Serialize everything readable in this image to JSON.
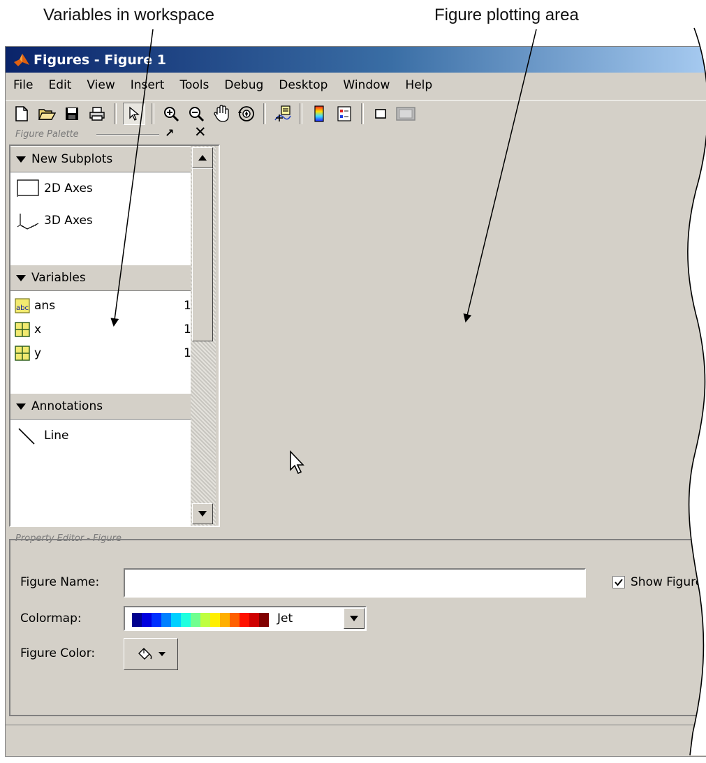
{
  "callouts": {
    "variables": "Variables in workspace",
    "figure": "Figure plotting area"
  },
  "window": {
    "title": "Figures - Figure 1"
  },
  "menu": [
    "File",
    "Edit",
    "View",
    "Insert",
    "Tools",
    "Debug",
    "Desktop",
    "Window",
    "Help"
  ],
  "toolbar": {
    "icons": [
      "new-figure-icon",
      "open-file-icon",
      "save-icon",
      "print-icon",
      "edit-plot-arrow-icon",
      "zoom-in-icon",
      "zoom-out-icon",
      "pan-hand-icon",
      "rotate-3d-icon",
      "data-cursor-icon",
      "insert-colorbar-icon",
      "insert-legend-icon",
      "hide-plot-tools-icon",
      "show-plot-tools-icon"
    ]
  },
  "palette": {
    "caption": "Figure Palette",
    "sections": {
      "subplots": "New Subplots",
      "variables": "Variables",
      "annotations": "Annotations"
    },
    "subplots": [
      "2D Axes",
      "3D Axes"
    ],
    "variables": [
      {
        "name": "ans",
        "size": "1",
        "icon": "char-variable-icon"
      },
      {
        "name": "x",
        "size": "1",
        "icon": "matrix-variable-icon"
      },
      {
        "name": "y",
        "size": "1",
        "icon": "matrix-variable-icon"
      }
    ],
    "annotations": [
      "Line"
    ]
  },
  "property_editor": {
    "caption": "Property Editor - Figure",
    "figure_name_label": "Figure Name:",
    "figure_name_value": "",
    "show_figure_label": "Show Figure",
    "show_figure_checked": true,
    "colormap_label": "Colormap:",
    "colormap_value": "Jet",
    "figure_color_label": "Figure Color:"
  },
  "colors": {
    "titlebar_start": "#0a246a",
    "panel_bg": "#d4d0c8",
    "jet": [
      "#00008f",
      "#0000df",
      "#0030ff",
      "#0080ff",
      "#00d0ff",
      "#20ffdf",
      "#70ff8f",
      "#bfff40",
      "#ffef00",
      "#ffaf00",
      "#ff6000",
      "#ff1000",
      "#cf0000",
      "#800000"
    ]
  }
}
